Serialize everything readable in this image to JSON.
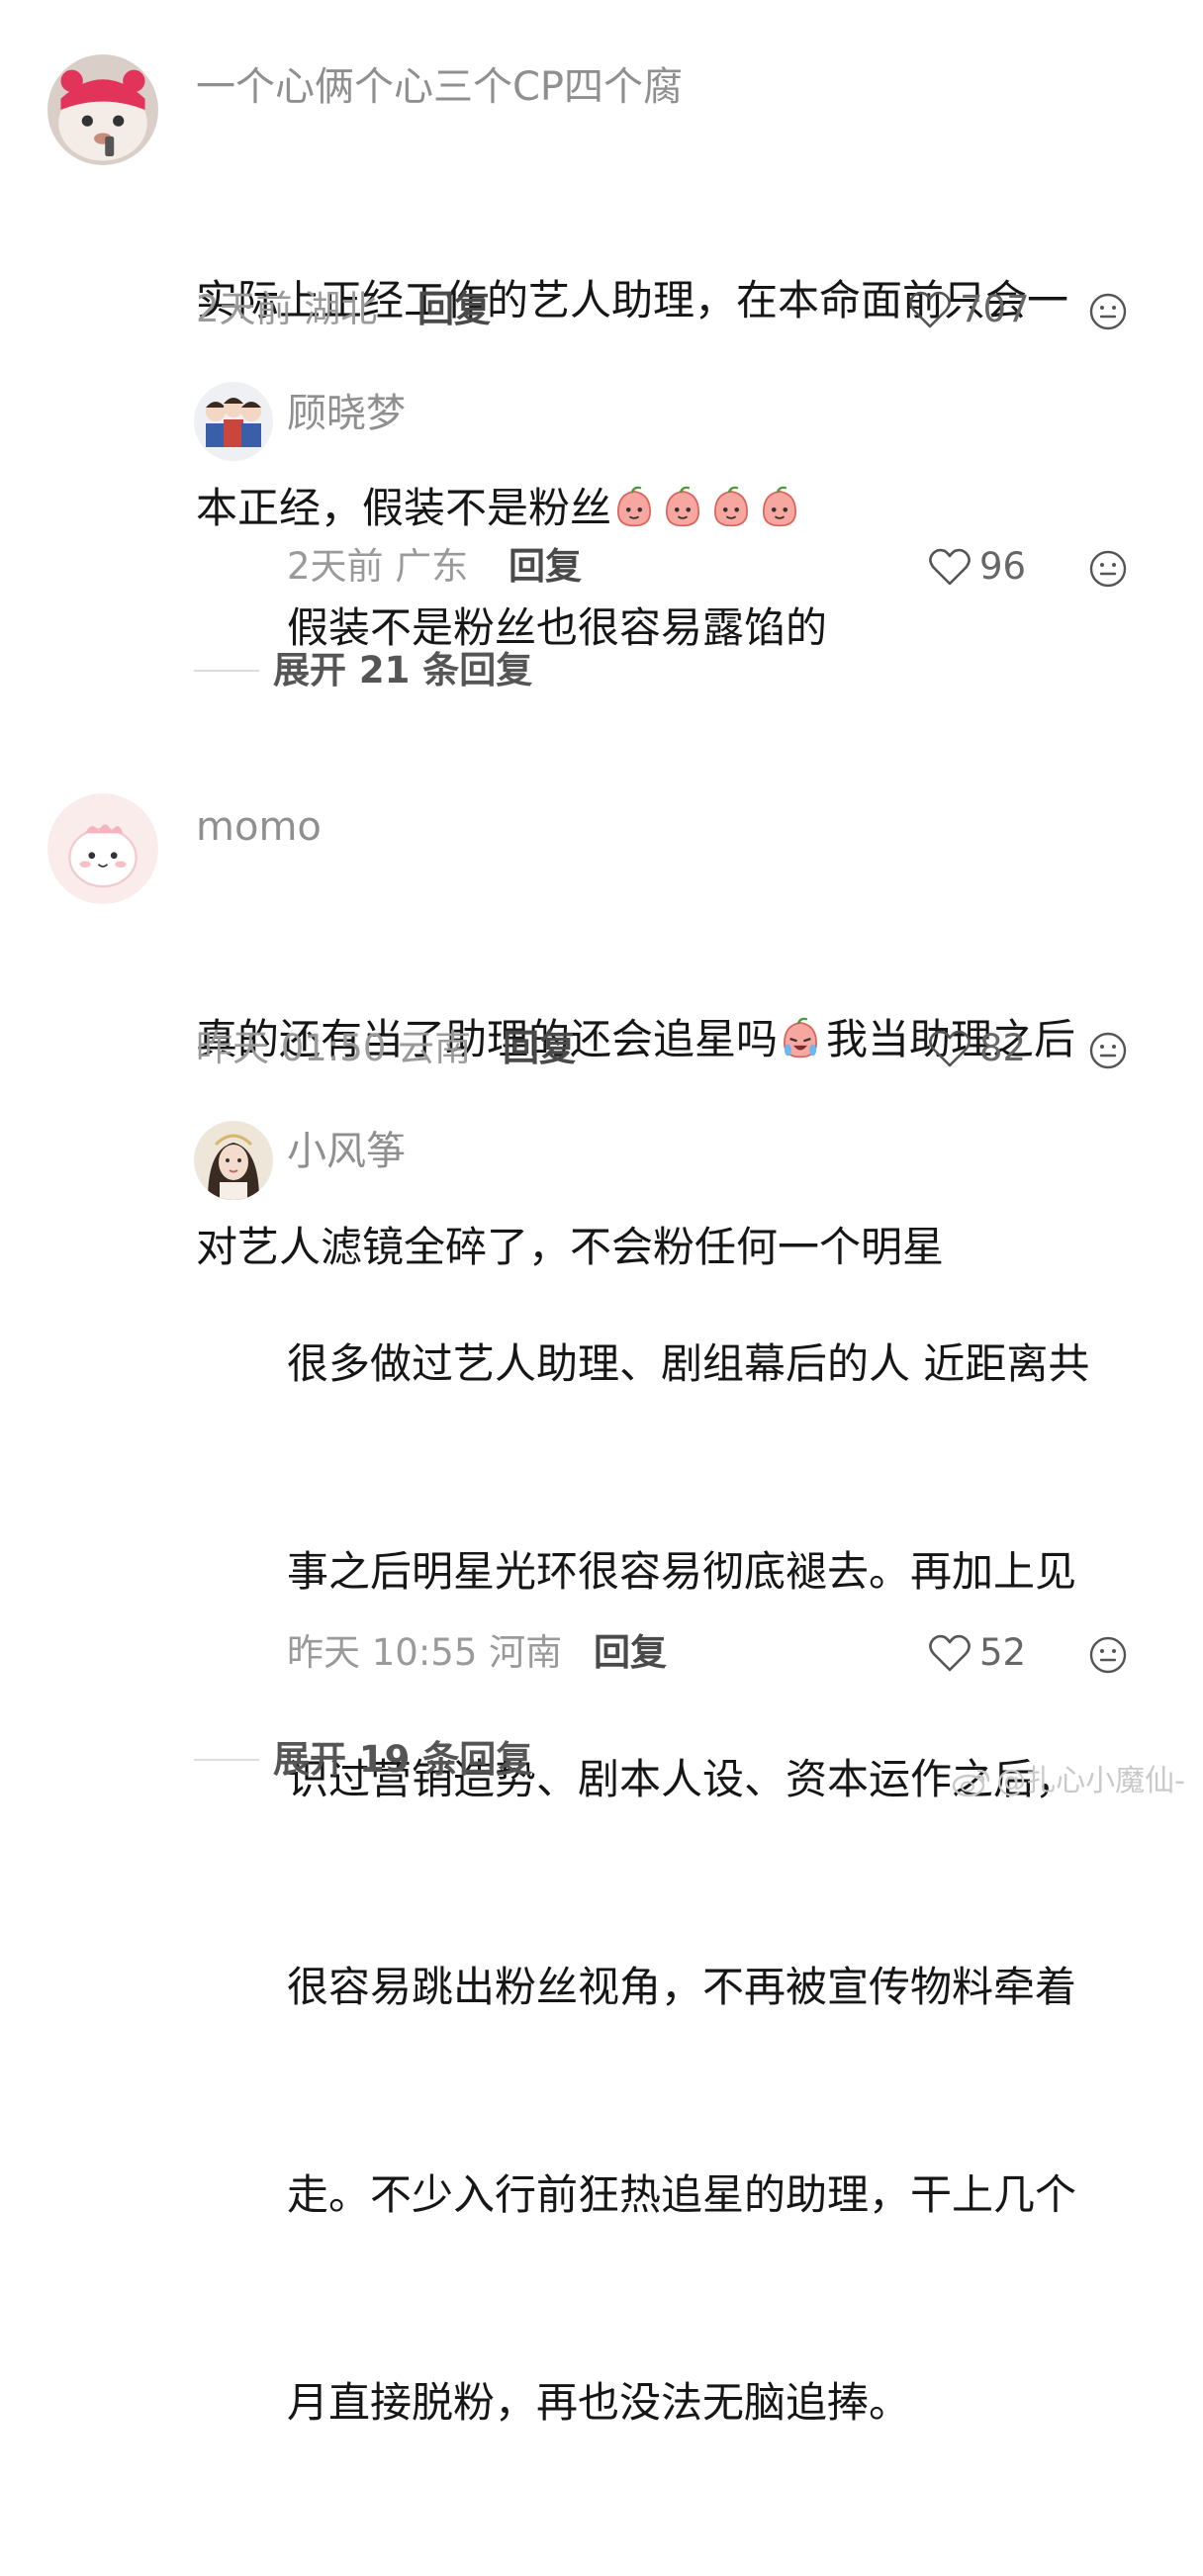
{
  "comments": [
    {
      "username": "一个心俩个心三个CP四个腐",
      "lines": [
        "实际上正经工作的艺人助理，在本命面前只会一",
        "本正经，假装不是粉丝"
      ],
      "emoji_after_line2": [
        "peach-face-emoji",
        "peach-face-emoji",
        "peach-face-emoji",
        "peach-face-emoji"
      ],
      "time_location": "2天前 湖北",
      "reply_label": "回复",
      "likes": "707"
    },
    {
      "username": "顾晓梦",
      "lines": [
        "假装不是粉丝也很容易露馅的"
      ],
      "time_location": "2天前 广东",
      "reply_label": "回复",
      "likes": "96"
    },
    {
      "username": "momo",
      "lines_parts": [
        [
          "真的还有当了助理的还会追星吗",
          "我当助理之后"
        ],
        [
          "对艺人滤镜全碎了，不会粉任何一个明星"
        ]
      ],
      "emoji_inline": "crying-laugh-emoji",
      "time_location": "昨天 01:50 云南",
      "reply_label": "回复",
      "likes": "82"
    },
    {
      "username": "小风筝",
      "lines": [
        "很多做过艺人助理、剧组幕后的人 近距离共",
        "事之后明星光环很容易彻底褪去。再加上见",
        "识过营销造势、剧本人设、资本运作之后，",
        "很容易跳出粉丝视角，不再被宣传物料牵着",
        "走。不少入行前狂热追星的助理，干上几个",
        "月直接脱粉，再也没法无脑追捧。"
      ],
      "time_location": "昨天 10:55 河南",
      "reply_label": "回复",
      "likes": "52"
    }
  ],
  "expand_1": "展开 21 条回复",
  "expand_2": "展开 19 条回复",
  "watermark": "@扎心小魔仙-",
  "colors": {
    "username": "#8f8f8f",
    "text": "#161616",
    "meta": "#9a9a9a"
  }
}
